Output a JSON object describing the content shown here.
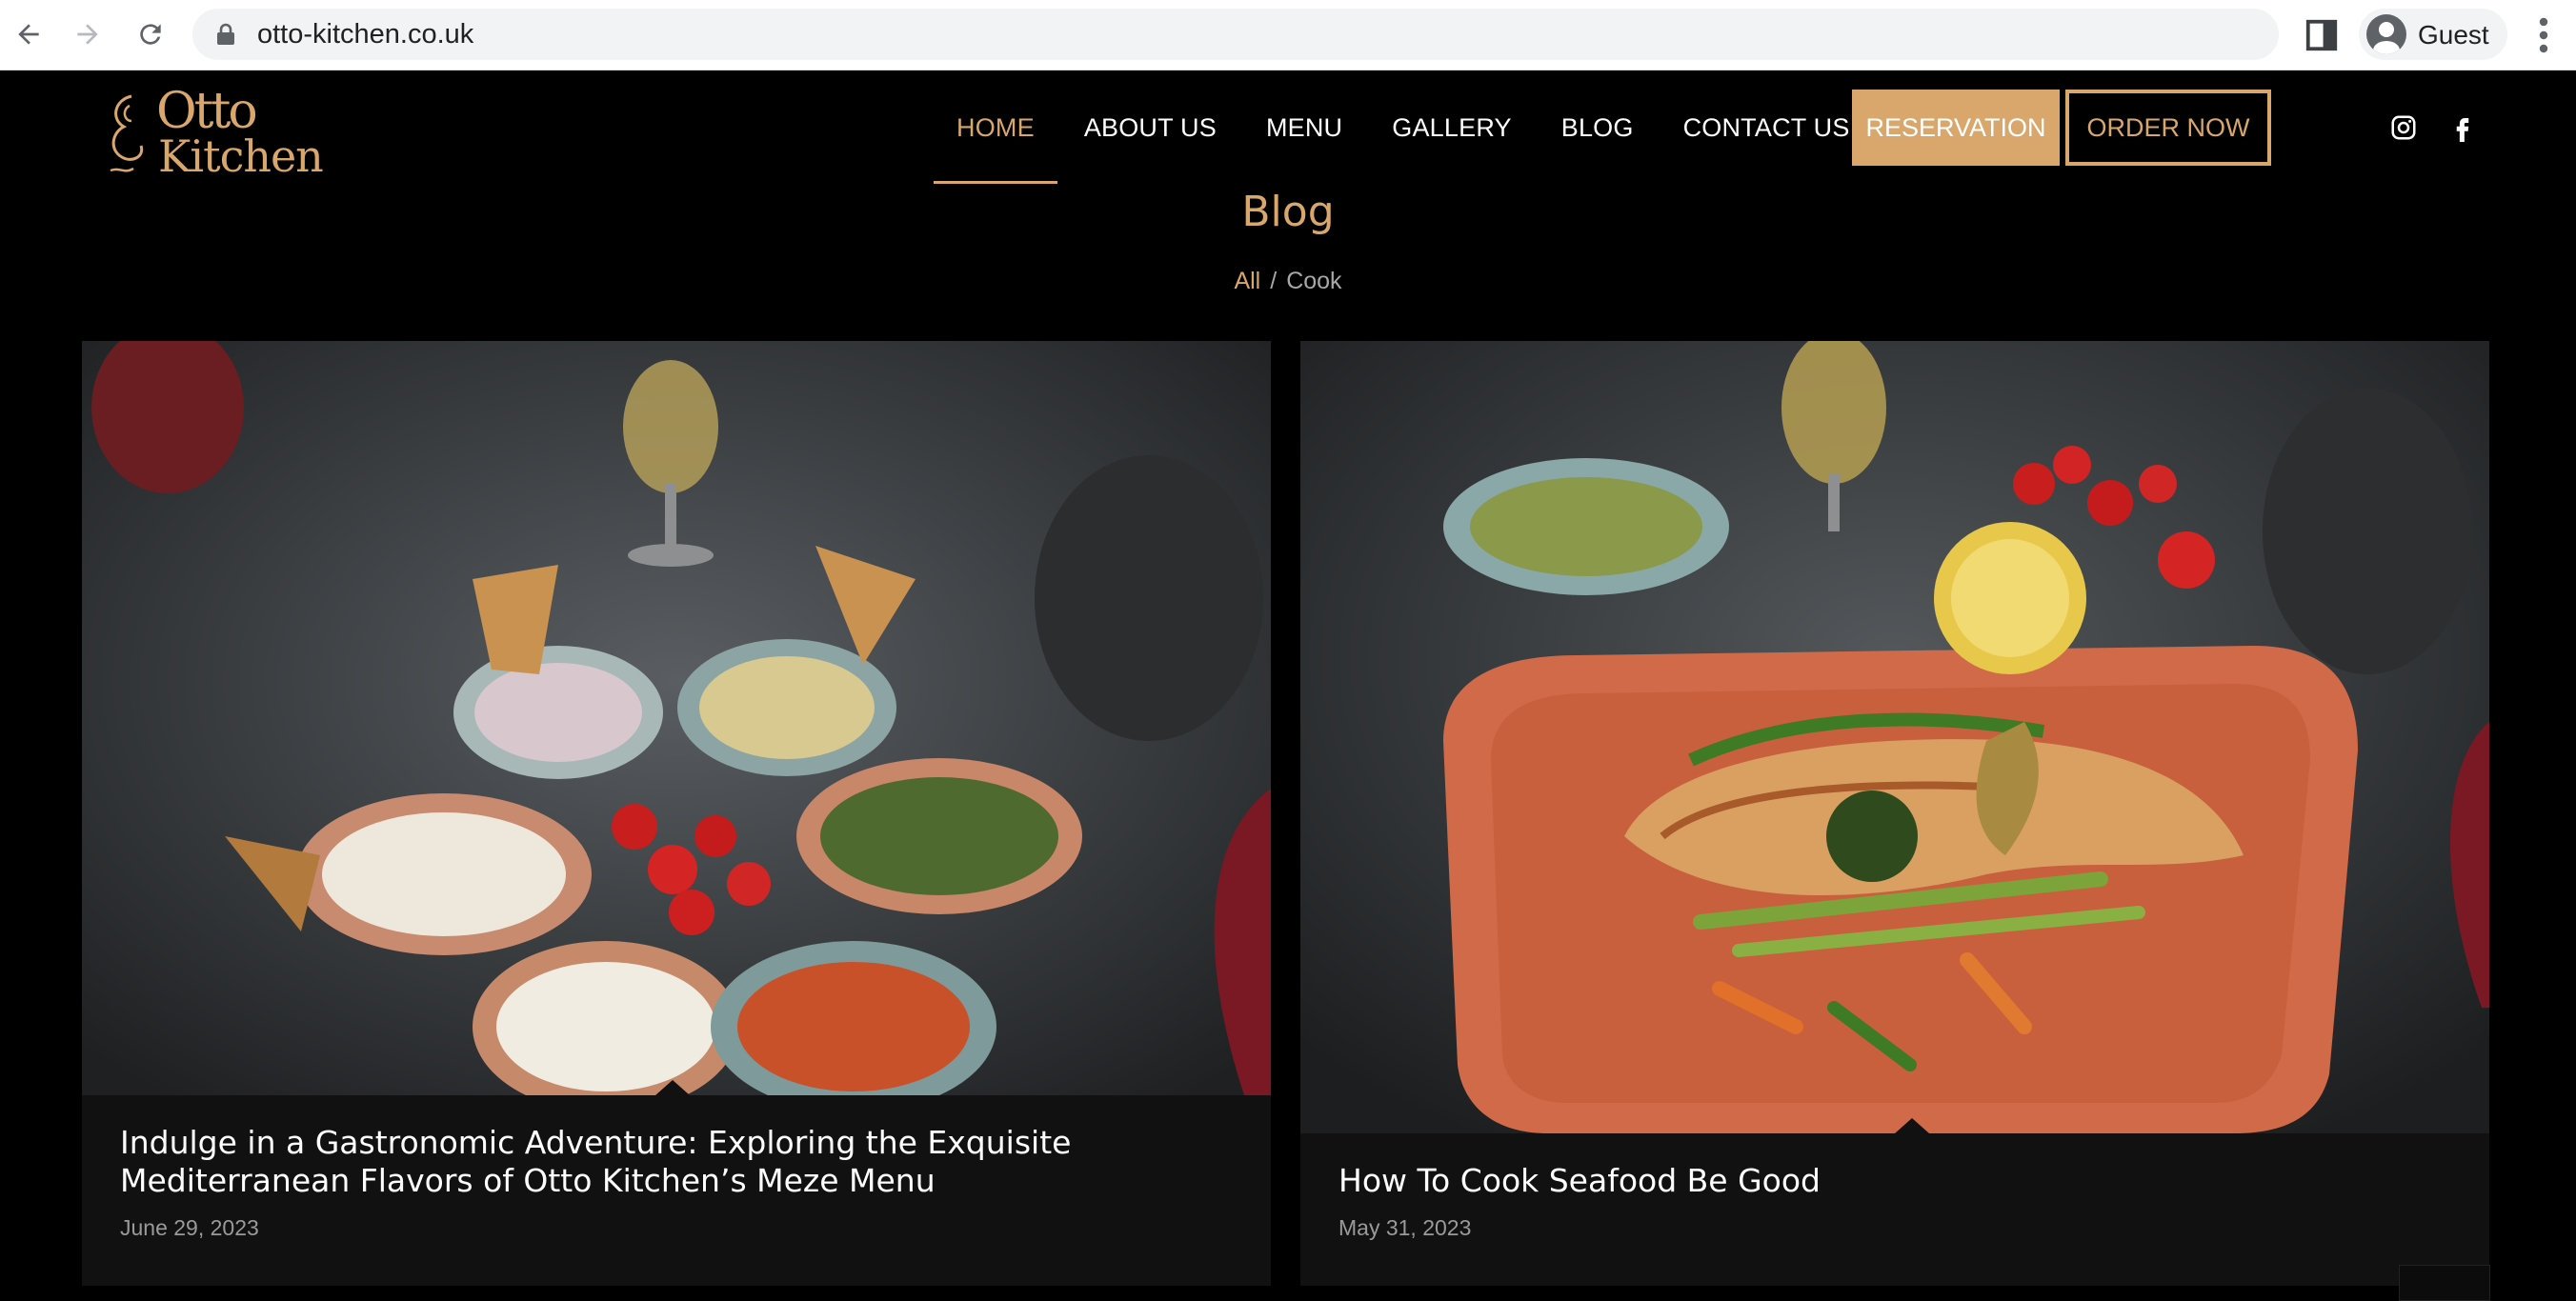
{
  "browser": {
    "url": "otto-kitchen.co.uk",
    "profile_label": "Guest"
  },
  "site": {
    "logo_top": "Otto",
    "logo_bottom": "Kitchen",
    "nav": [
      {
        "label": "HOME"
      },
      {
        "label": "ABOUT US"
      },
      {
        "label": "MENU"
      },
      {
        "label": "GALLERY"
      },
      {
        "label": "BLOG"
      },
      {
        "label": "CONTACT US"
      }
    ],
    "reservation_label": "RESERVATION",
    "order_label": "ORDER NOW",
    "accent_color": "#d9a76b",
    "social": [
      "instagram-icon",
      "facebook-icon"
    ]
  },
  "page": {
    "title": "Blog",
    "breadcrumb_all": "All",
    "breadcrumb_sep": "/",
    "breadcrumb_current": "Cook"
  },
  "posts": [
    {
      "title": "Indulge in a Gastronomic Adventure: Exploring the Exquisite Mediterranean Flavors of Otto Kitchen’s Meze Menu",
      "date": "June 29, 2023"
    },
    {
      "title": "How To Cook Seafood Be Good",
      "date": "May 31, 2023"
    }
  ]
}
